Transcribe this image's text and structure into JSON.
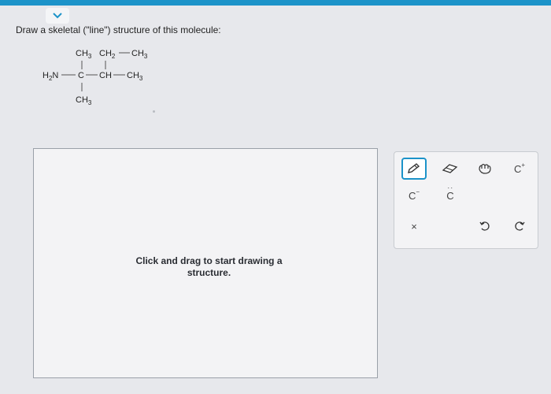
{
  "prompt": "Draw a skeletal (\"line\") structure of this molecule:",
  "molecule": {
    "ch3_top": "CH3",
    "ch2": "CH2",
    "ch3_right_top": "CH3",
    "h2n": "H2N",
    "c": "C",
    "ch": "CH",
    "ch3_right": "CH3",
    "ch3_bottom": "CH3"
  },
  "canvas": {
    "hint_line1": "Click and drag to start drawing a",
    "hint_line2": "structure."
  },
  "toolbar": {
    "tools": [
      {
        "name": "pencil",
        "label": ""
      },
      {
        "name": "eraser",
        "label": ""
      },
      {
        "name": "hand",
        "label": ""
      },
      {
        "name": "carbocation",
        "label": "C"
      },
      {
        "name": "carbanion",
        "label": "C"
      },
      {
        "name": "carbene",
        "label": "C"
      },
      {
        "name": "clear",
        "label": "×"
      },
      {
        "name": "undo",
        "label": ""
      },
      {
        "name": "redo",
        "label": ""
      }
    ]
  },
  "colors": {
    "accent": "#1c93c9",
    "panel": "#f3f3f5",
    "background": "#e7e8ec"
  }
}
